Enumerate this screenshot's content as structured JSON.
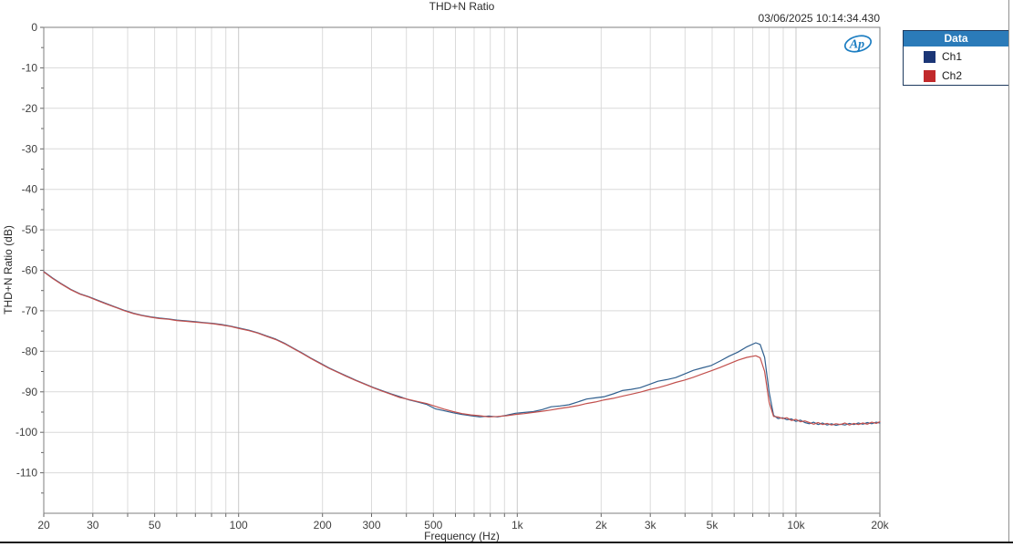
{
  "header": {
    "title": "THD+N Ratio",
    "timestamp": "03/06/2025 10:14:34.430"
  },
  "logo": {
    "text": "Ap"
  },
  "legend": {
    "title": "Data",
    "items": [
      {
        "label": "Ch1",
        "color": "#1b3676"
      },
      {
        "label": "Ch2",
        "color": "#c1292b"
      }
    ]
  },
  "chart_data": {
    "type": "line",
    "title": "THD+N Ratio",
    "xlabel": "Frequency (Hz)",
    "ylabel": "THD+N Ratio (dB)",
    "x_scale": "log",
    "xlim": [
      20,
      20000
    ],
    "ylim": [
      -120,
      0
    ],
    "grid": true,
    "legend_position": "top-right-outside",
    "y_major_ticks": [
      0,
      -10,
      -20,
      -30,
      -40,
      -50,
      -60,
      -70,
      -80,
      -90,
      -100,
      -110
    ],
    "y_minor_step": 5,
    "x_grid": [
      20,
      30,
      40,
      50,
      60,
      70,
      80,
      90,
      100,
      200,
      300,
      400,
      500,
      600,
      700,
      800,
      900,
      1000,
      2000,
      3000,
      4000,
      5000,
      6000,
      7000,
      8000,
      9000,
      10000,
      20000
    ],
    "x_ticks": [
      {
        "f": 20,
        "label": "20"
      },
      {
        "f": 30,
        "label": "30"
      },
      {
        "f": 50,
        "label": "50"
      },
      {
        "f": 100,
        "label": "100"
      },
      {
        "f": 200,
        "label": "200"
      },
      {
        "f": 300,
        "label": "300"
      },
      {
        "f": 500,
        "label": "500"
      },
      {
        "f": 1000,
        "label": "1k"
      },
      {
        "f": 2000,
        "label": "2k"
      },
      {
        "f": 3000,
        "label": "3k"
      },
      {
        "f": 5000,
        "label": "5k"
      },
      {
        "f": 10000,
        "label": "10k"
      },
      {
        "f": 20000,
        "label": "20k"
      }
    ],
    "colors": {
      "grid_minor": "#dbdbdb",
      "grid_decade": "#c9c9c9",
      "frame": "#7f7f7f",
      "tick_text": "#3f3f3f"
    },
    "series": [
      {
        "name": "Ch1",
        "color": "#305f8e",
        "x": [
          20,
          21.5,
          23,
          25,
          27,
          29,
          31,
          33.5,
          36,
          39,
          42,
          45,
          48.5,
          52,
          56,
          60,
          65,
          70,
          75,
          81,
          87,
          94,
          101,
          109,
          117,
          126,
          136,
          146,
          157,
          169,
          182,
          196,
          211,
          227,
          244,
          263,
          283,
          304,
          327,
          352,
          379,
          408,
          439,
          472,
          508,
          547,
          589,
          634,
          682,
          734,
          790,
          850,
          915,
          985,
          1060,
          1141,
          1228,
          1322,
          1423,
          1531,
          1648,
          1774,
          1909,
          2055,
          2212,
          2381,
          2562,
          2758,
          2968,
          3195,
          3439,
          3701,
          3983,
          4287,
          4614,
          4966,
          5345,
          5753,
          6192,
          6664,
          7172,
          7440,
          7719,
          8009,
          8309,
          8621,
          8945,
          9281,
          9630,
          9992,
          10367,
          10756,
          11160,
          11579,
          12014,
          12465,
          12933,
          13419,
          13922,
          14445,
          14988,
          15551,
          16134,
          16740,
          17369,
          18021,
          18697,
          19400,
          20000
        ],
        "y": [
          -60.3,
          -61.9,
          -63.2,
          -64.7,
          -65.8,
          -66.5,
          -67.3,
          -68.2,
          -69.0,
          -69.9,
          -70.6,
          -71.1,
          -71.5,
          -71.8,
          -72.0,
          -72.3,
          -72.5,
          -72.7,
          -72.9,
          -73.1,
          -73.4,
          -73.8,
          -74.3,
          -74.8,
          -75.4,
          -76.2,
          -77.0,
          -78.0,
          -79.2,
          -80.4,
          -81.7,
          -82.9,
          -84.1,
          -85.1,
          -86.1,
          -87.1,
          -88.0,
          -88.9,
          -89.7,
          -90.5,
          -91.2,
          -92.0,
          -92.5,
          -93.1,
          -94.2,
          -94.7,
          -95.2,
          -95.6,
          -95.9,
          -96.2,
          -96.0,
          -96.2,
          -95.8,
          -95.3,
          -95.1,
          -94.9,
          -94.4,
          -93.7,
          -93.5,
          -93.2,
          -92.5,
          -91.8,
          -91.5,
          -91.2,
          -90.5,
          -89.7,
          -89.4,
          -89.0,
          -88.2,
          -87.4,
          -87.0,
          -86.5,
          -85.6,
          -84.7,
          -84.1,
          -83.5,
          -82.4,
          -81.2,
          -80.2,
          -78.9,
          -77.9,
          -78.3,
          -81.5,
          -90.0,
          -95.8,
          -96.6,
          -96.4,
          -96.9,
          -96.7,
          -97.3,
          -97.0,
          -97.6,
          -97.9,
          -97.5,
          -98.1,
          -97.7,
          -98.2,
          -97.9,
          -98.3,
          -98.0,
          -98.2,
          -97.8,
          -98.1,
          -97.7,
          -98.0,
          -97.6,
          -97.9,
          -97.5,
          -97.7
        ]
      },
      {
        "name": "Ch2",
        "color": "#c2504d",
        "x": [
          20,
          21.5,
          23,
          25,
          27,
          29,
          31,
          33.5,
          36,
          39,
          42,
          45,
          48.5,
          52,
          56,
          60,
          65,
          70,
          75,
          81,
          87,
          94,
          101,
          109,
          117,
          126,
          136,
          146,
          157,
          169,
          182,
          196,
          211,
          227,
          244,
          263,
          283,
          304,
          327,
          352,
          379,
          408,
          439,
          472,
          508,
          547,
          589,
          634,
          682,
          734,
          790,
          850,
          915,
          985,
          1060,
          1141,
          1228,
          1322,
          1423,
          1531,
          1648,
          1774,
          1909,
          2055,
          2212,
          2381,
          2562,
          2758,
          2968,
          3195,
          3439,
          3701,
          3983,
          4287,
          4614,
          4966,
          5345,
          5753,
          6192,
          6664,
          7172,
          7440,
          7719,
          8009,
          8309,
          8621,
          8945,
          9281,
          9630,
          9992,
          10367,
          10756,
          11160,
          11579,
          12014,
          12465,
          12933,
          13419,
          13922,
          14445,
          14988,
          15551,
          16134,
          16740,
          17369,
          18021,
          18697,
          19400,
          20000
        ],
        "y": [
          -60.4,
          -62.0,
          -63.3,
          -64.8,
          -65.9,
          -66.6,
          -67.4,
          -68.3,
          -69.1,
          -70.0,
          -70.7,
          -71.2,
          -71.6,
          -71.9,
          -72.1,
          -72.4,
          -72.6,
          -72.8,
          -73.0,
          -73.2,
          -73.5,
          -73.9,
          -74.4,
          -74.9,
          -75.5,
          -76.3,
          -77.1,
          -78.1,
          -79.3,
          -80.5,
          -81.8,
          -83.0,
          -84.2,
          -85.2,
          -86.2,
          -87.2,
          -88.1,
          -89.0,
          -89.8,
          -90.6,
          -91.4,
          -91.9,
          -92.4,
          -92.9,
          -93.6,
          -94.3,
          -94.9,
          -95.4,
          -95.7,
          -95.9,
          -96.2,
          -96.1,
          -95.9,
          -95.6,
          -95.4,
          -95.1,
          -94.8,
          -94.5,
          -94.1,
          -93.8,
          -93.4,
          -92.9,
          -92.5,
          -92.0,
          -91.6,
          -91.1,
          -90.6,
          -90.1,
          -89.5,
          -89.0,
          -88.4,
          -87.7,
          -87.1,
          -86.4,
          -85.6,
          -84.8,
          -84.0,
          -83.1,
          -82.2,
          -81.5,
          -81.1,
          -81.6,
          -85.0,
          -92.5,
          -96.1,
          -96.2,
          -96.6,
          -96.4,
          -97.1,
          -96.8,
          -97.4,
          -97.2,
          -97.6,
          -98.0,
          -97.6,
          -98.1,
          -97.8,
          -98.2,
          -97.9,
          -98.1,
          -97.7,
          -98.2,
          -97.8,
          -98.1,
          -97.7,
          -98.0,
          -97.5,
          -97.8,
          -97.4
        ]
      }
    ]
  }
}
